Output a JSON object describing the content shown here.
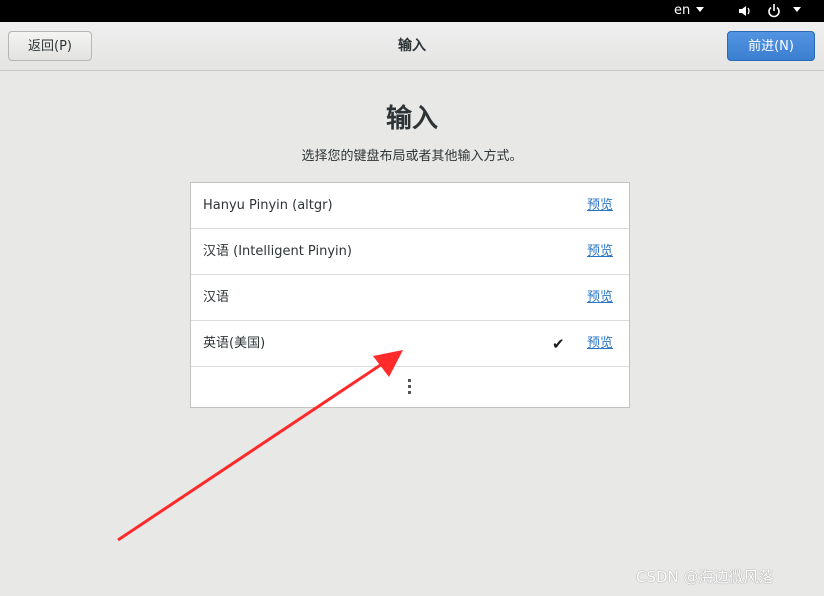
{
  "system_bar": {
    "language": "en",
    "icons": [
      "volume-icon",
      "power-icon",
      "chevron-down-icon"
    ]
  },
  "header": {
    "back_label": "返回(P)",
    "title": "输入",
    "next_label": "前进(N)",
    "next_color": "#4a8ad9"
  },
  "main": {
    "title": "输入",
    "subtitle": "选择您的键盘布局或者其他输入方式。",
    "items": [
      {
        "label": "Hanyu Pinyin (altgr)",
        "preview": "预览",
        "selected": false
      },
      {
        "label": "汉语 (Intelligent Pinyin)",
        "preview": "预览",
        "selected": false
      },
      {
        "label": "汉语",
        "preview": "预览",
        "selected": false
      },
      {
        "label": "英语(美国)",
        "preview": "预览",
        "selected": true,
        "check": "✔"
      }
    ],
    "more_icon": "more-vertical-icon"
  },
  "annotation": {
    "color": "#ff2a2a"
  },
  "watermark": "CSDN @海边微风落"
}
